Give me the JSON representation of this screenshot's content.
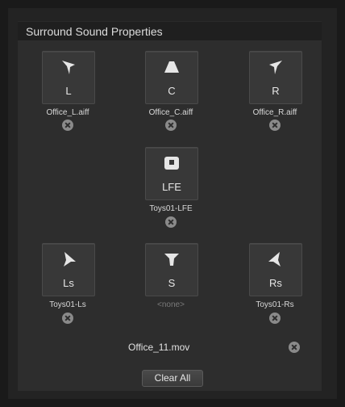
{
  "header": {
    "title": "Surround Sound Properties"
  },
  "channels": {
    "l": {
      "label": "L",
      "file": "Office_L.aiff",
      "icon": "speaker-front-left-icon"
    },
    "c": {
      "label": "C",
      "file": "Office_C.aiff",
      "icon": "speaker-center-icon"
    },
    "r": {
      "label": "R",
      "file": "Office_R.aiff",
      "icon": "speaker-front-right-icon"
    },
    "lfe": {
      "label": "LFE",
      "file": "Toys01-LFE",
      "icon": "subwoofer-icon"
    },
    "ls": {
      "label": "Ls",
      "file": "Toys01-Ls",
      "icon": "speaker-surround-left-icon"
    },
    "s": {
      "label": "S",
      "file": "<none>",
      "icon": "speaker-surround-icon"
    },
    "rs": {
      "label": "Rs",
      "file": "Toys01-Rs",
      "icon": "speaker-surround-right-icon"
    }
  },
  "source": {
    "file": "Office_11.mov"
  },
  "actions": {
    "clear_all": "Clear All"
  },
  "colors": {
    "panel": "#232323",
    "tile": "#383838",
    "text": "#e6e6e6",
    "remove_icon": "#8a8a8a"
  }
}
